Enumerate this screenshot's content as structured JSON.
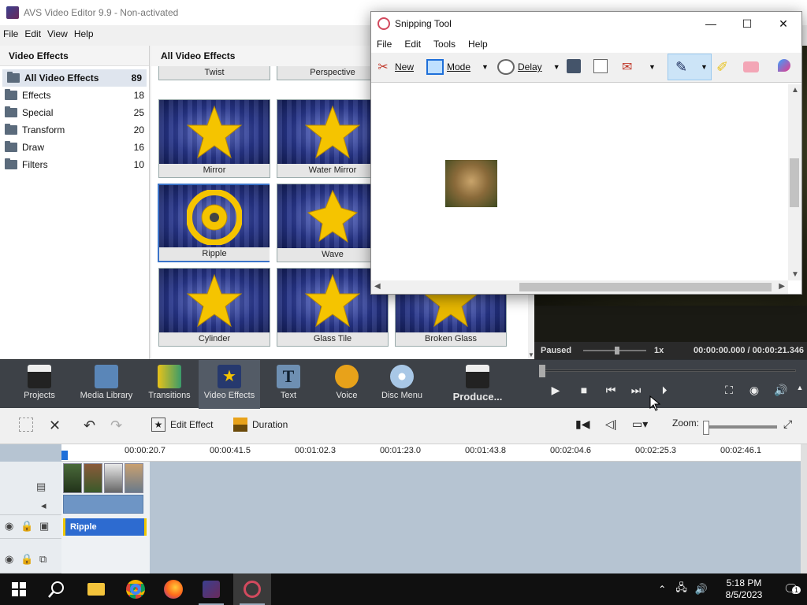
{
  "avs": {
    "title": "AVS Video Editor 9.9 - Non-activated",
    "menu": [
      "File",
      "Edit",
      "View",
      "Help"
    ],
    "left_panel": {
      "header": "Video Effects",
      "categories": [
        {
          "label": "All Video Effects",
          "count": "89"
        },
        {
          "label": "Effects",
          "count": "18"
        },
        {
          "label": "Special",
          "count": "25"
        },
        {
          "label": "Transform",
          "count": "20"
        },
        {
          "label": "Draw",
          "count": "16"
        },
        {
          "label": "Filters",
          "count": "10"
        }
      ]
    },
    "effects_panel": {
      "header": "All Video Effects",
      "tiles": [
        "Twist",
        "Perspective",
        "Mirror",
        "Water Mirror",
        "Ripple",
        "Wave",
        "Cylinder",
        "Glass Tile",
        "Broken Glass"
      ],
      "selected": "Ripple"
    },
    "preview": {
      "status": "Paused",
      "speed": "1x",
      "time": "00:00:00.000 / 00:00:21.346"
    },
    "toolbar": [
      {
        "label": "Projects",
        "icon": "clapperboard-icon"
      },
      {
        "label": "Media Library",
        "icon": "film-icon"
      },
      {
        "label": "Transitions",
        "icon": "transitions-icon"
      },
      {
        "label": "Video Effects",
        "icon": "star-effect-icon"
      },
      {
        "label": "Text",
        "icon": "text-t-icon"
      },
      {
        "label": "Voice",
        "icon": "microphone-icon"
      },
      {
        "label": "Disc Menu",
        "icon": "disc-icon"
      },
      {
        "label": "Produce...",
        "icon": "produce-icon"
      }
    ],
    "edit_toolbar": {
      "edit_effect": "Edit Effect",
      "duration": "Duration",
      "zoom_label": "Zoom:"
    },
    "timeline": {
      "ticks": [
        "00:00:20.7",
        "00:00:41.5",
        "00:01:02.3",
        "00:01:23.0",
        "00:01:43.8",
        "00:02:04.6",
        "00:02:25.3",
        "00:02:46.1"
      ],
      "effect_clip": "Ripple"
    }
  },
  "snipping_tool": {
    "title": "Snipping Tool",
    "menu": [
      "File",
      "Edit",
      "Tools",
      "Help"
    ],
    "new": "New",
    "mode": "Mode",
    "delay": "Delay"
  },
  "taskbar": {
    "time": "5:18 PM",
    "date": "8/5/2023",
    "notification_count": "1"
  },
  "colors": {
    "accent": "#3b74c9",
    "toolbar_bg": "#3d4147",
    "effect_clip": "#2d6bd0"
  }
}
